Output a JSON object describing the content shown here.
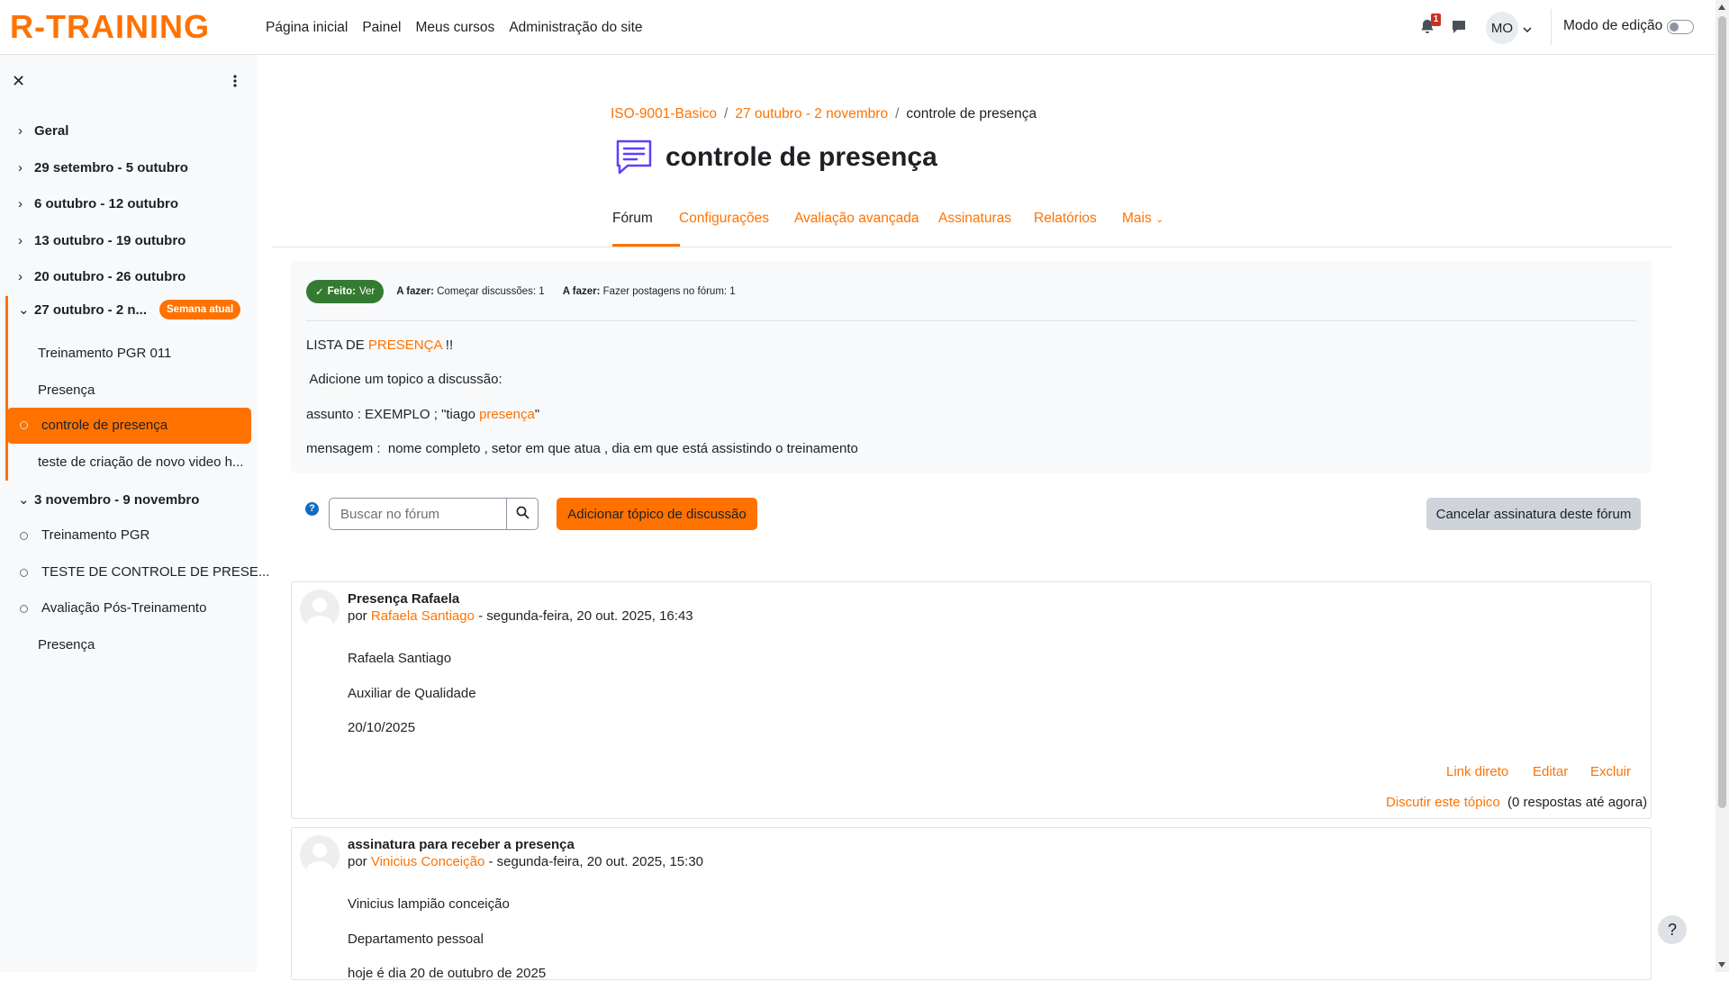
{
  "brand": {
    "logo_text": "R-TRAINING",
    "accent": "#ff7200"
  },
  "nav": {
    "links": [
      "Página inicial",
      "Painel",
      "Meus cursos",
      "Administração do site"
    ],
    "notifications_count": "1",
    "user_initials": "MO",
    "edit_mode_label": "Modo de edição",
    "edit_mode_on": false
  },
  "drawer": {
    "close_icon": "close-icon",
    "sections": [
      {
        "label": "Geral",
        "expanded": false
      },
      {
        "label": "29 setembro - 5 outubro",
        "expanded": false
      },
      {
        "label": "6 outubro - 12 outubro",
        "expanded": false
      },
      {
        "label": "13 outubro - 19 outubro",
        "expanded": false
      },
      {
        "label": "20 outubro - 26 outubro",
        "expanded": false
      },
      {
        "label": "27 outubro - 2 n...",
        "expanded": true,
        "badge": "Semana atual"
      },
      {
        "label": "3 novembro - 9 novembro",
        "expanded": true
      }
    ],
    "current_week_activities": [
      "Treinamento PGR 011",
      "Presença",
      "controle de presença",
      "teste de criação de novo video h..."
    ],
    "next_week_activities": [
      "Treinamento PGR",
      "TESTE DE CONTROLE DE PRESE...",
      "Avaliação Pós-Treinamento",
      "Presença"
    ]
  },
  "breadcrumb": {
    "items": [
      "ISO-9001-Basico",
      "27 outubro - 2 novembro"
    ],
    "current": "controle de presença"
  },
  "page": {
    "title": "controle de presença"
  },
  "tabs": {
    "items": [
      "Fórum",
      "Configurações",
      "Avaliação avançada",
      "Assinaturas",
      "Relatórios",
      "Mais"
    ],
    "active": "Fórum"
  },
  "completion": {
    "done_label": "Feito:",
    "done_value": "Ver",
    "todo1_label": "A fazer:",
    "todo1_value": "Começar discussões: 1",
    "todo2_label": "A fazer:",
    "todo2_value": "Fazer postagens no fórum: 1"
  },
  "intro": {
    "line1_prefix": "LISTA DE ",
    "line1_highlight": "PRESENÇA",
    "line1_suffix": " !!",
    "line2": " Adicione um topico a discussão:",
    "line3_prefix": "assunto : EXEMPLO ; \"tiago ",
    "line3_highlight": "presença",
    "line3_suffix": "\"",
    "line4": "mensagem :  nome completo , setor em que atua , dia em que está assistindo o treinamento"
  },
  "toolbar": {
    "search_placeholder": "Buscar no fórum",
    "add_topic_label": "Adicionar tópico de discussão",
    "unsubscribe_label": "Cancelar assinatura deste fórum"
  },
  "posts": [
    {
      "subject": "Presença Rafaela",
      "by": "por ",
      "author": "Rafaela Santiago",
      "date": " - segunda-feira, 20 out. 2025, 16:43",
      "lines": [
        "Rafaela Santiago",
        "Auxiliar de Qualidade",
        "20/10/2025"
      ],
      "actions": [
        "Link direto",
        "Editar",
        "Excluir"
      ],
      "discuss_label": "Discutir este tópico",
      "replies": "(0 respostas até agora)"
    },
    {
      "subject": "assinatura para receber a presença",
      "by": "por ",
      "author": "Vinicius Conceição",
      "date": " - segunda-feira, 20 out. 2025, 15:30",
      "lines": [
        "Vinicius lampião conceição",
        "Departamento pessoal",
        "hoje é dia 20 de outubro de 2025"
      ]
    }
  ],
  "help_button": "?"
}
